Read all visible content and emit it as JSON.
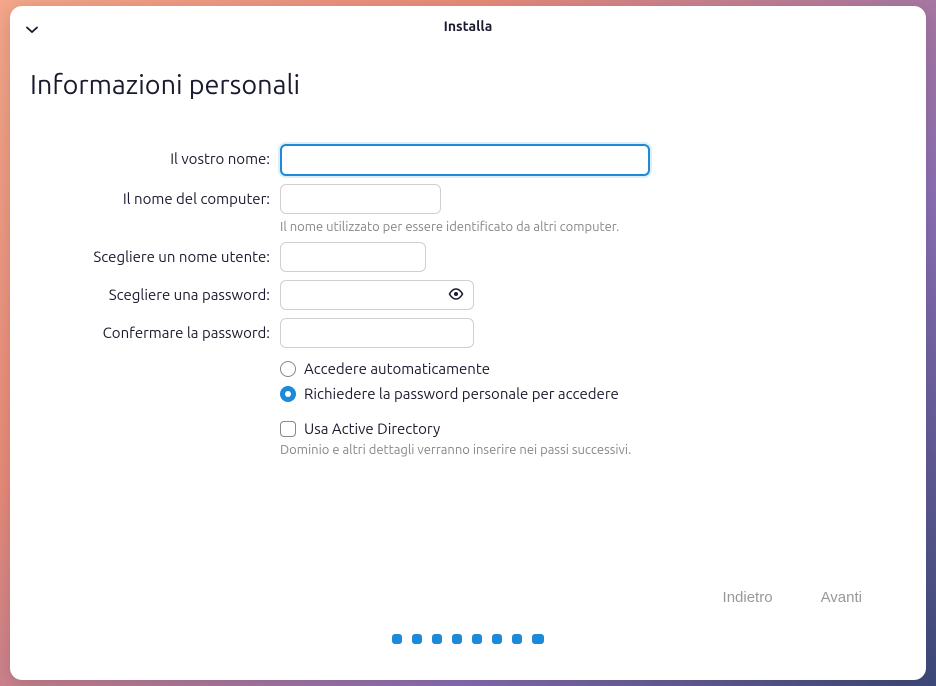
{
  "window": {
    "title": "Installa"
  },
  "page": {
    "title": "Informazioni personali"
  },
  "fields": {
    "name": {
      "label": "Il vostro nome:",
      "value": ""
    },
    "computer": {
      "label": "Il nome del computer:",
      "value": "",
      "help": "Il nome utilizzato per essere identificato da altri computer."
    },
    "username": {
      "label": "Scegliere un nome utente:",
      "value": ""
    },
    "password": {
      "label": "Scegliere una password:",
      "value": ""
    },
    "confirm": {
      "label": "Confermare la password:",
      "value": ""
    }
  },
  "login_options": {
    "auto": "Accedere automaticamente",
    "require": "Richiedere la password personale per accedere",
    "selected": "require"
  },
  "active_directory": {
    "label": "Usa Active Directory",
    "help": "Dominio e altri dettagli verranno inserire nei passi successivi.",
    "checked": false
  },
  "nav": {
    "back": "Indietro",
    "forward": "Avanti"
  },
  "progress": {
    "total": 8,
    "current": 8
  }
}
